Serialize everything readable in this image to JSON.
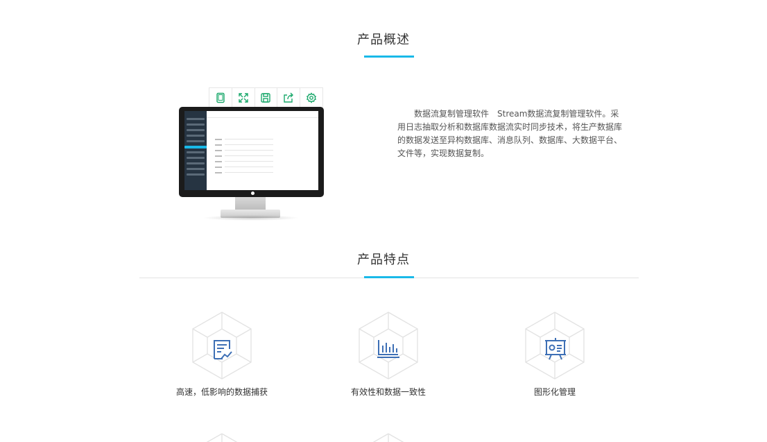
{
  "overview": {
    "title": "产品概述",
    "toolbar_icons": [
      "tablet-icon",
      "expand-icon",
      "save-icon",
      "share-icon",
      "settings-icon"
    ],
    "description": "数据流复制管理软件　Stream数据流复制管理软件。采用日志抽取分析和数据库数据流实时同步技术，将生产数据库的数据发送至异构数据库、消息队列、数据库、大数据平台、文件等，实现数据复制。"
  },
  "features": {
    "title": "产品特点",
    "items": [
      {
        "label": "高速，低影响的数据捕获",
        "icon": "report-chart-icon"
      },
      {
        "label": "有效性和数据一致性",
        "icon": "bar-chart-icon"
      },
      {
        "label": "图形化管理",
        "icon": "presentation-board-icon"
      }
    ]
  },
  "colors": {
    "accent": "#19b9e8",
    "icon_green": "#1aa86b",
    "icon_blue": "#3d6fb5"
  }
}
